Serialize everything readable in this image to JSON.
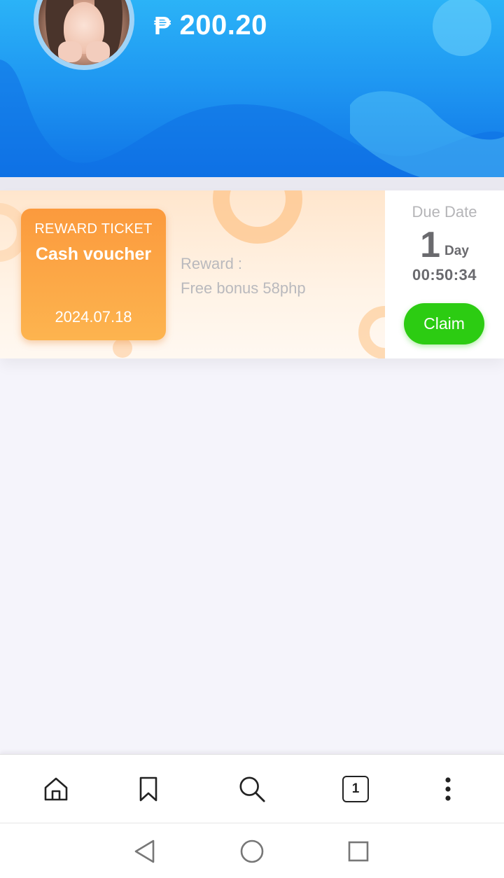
{
  "header": {
    "currency_symbol": "₱",
    "balance": "200.20"
  },
  "voucher": {
    "ticket_tag": "REWARD TICKET",
    "ticket_title": "Cash voucher",
    "ticket_date": "2024.07.18",
    "reward_label": "Reward :",
    "reward_value": "Free bonus 58php",
    "due_label": "Due Date",
    "due_days": "1",
    "due_unit": "Day",
    "due_time": "00:50:34",
    "claim_label": "Claim"
  },
  "toolbar": {
    "tab_count": "1",
    "icons": [
      "home-icon",
      "bookmark-icon",
      "search-icon",
      "tabs-icon",
      "more-vertical-icon"
    ]
  },
  "navbar": {
    "icons": [
      "back-icon",
      "home-circle-icon",
      "recents-icon"
    ]
  },
  "colors": {
    "header_top": "#2bb3f7",
    "header_bottom": "#0f73e6",
    "ticket": "#fb9a3d",
    "claim": "#2ccc12",
    "page_bg": "#f5f4fb"
  }
}
